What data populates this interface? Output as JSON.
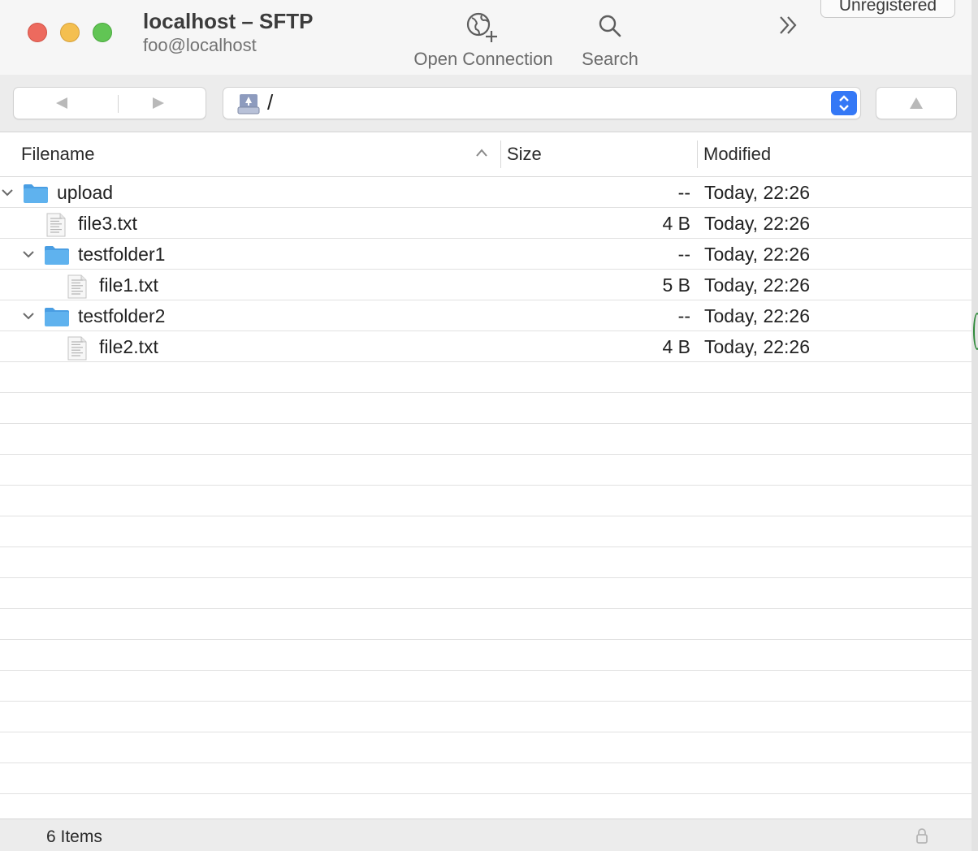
{
  "window": {
    "title": "localhost – SFTP",
    "subtitle": "foo@localhost"
  },
  "toolbar": {
    "open_connection_label": "Open Connection",
    "search_label": "Search",
    "unregistered_label": "Unregistered",
    "icons": {
      "open_connection": "globe-plus-icon",
      "search": "magnifier-icon",
      "more": "chevron-double-right-icon"
    }
  },
  "navigation": {
    "path": "/",
    "back_icon": "triangle-left-icon",
    "forward_icon": "triangle-right-icon",
    "up_icon": "triangle-up-icon"
  },
  "table": {
    "columns": {
      "filename": "Filename",
      "size": "Size",
      "modified": "Modified"
    },
    "sort": {
      "column": "Filename",
      "direction": "ascending"
    },
    "rows": [
      {
        "name": "upload",
        "type": "folder",
        "expanded": true,
        "depth": 0,
        "size": "--",
        "modified": "Today, 22:26"
      },
      {
        "name": "file3.txt",
        "type": "file",
        "depth": 1,
        "size": "4 B",
        "modified": "Today, 22:26"
      },
      {
        "name": "testfolder1",
        "type": "folder",
        "expanded": true,
        "depth": 1,
        "size": "--",
        "modified": "Today, 22:26"
      },
      {
        "name": "file1.txt",
        "type": "file",
        "depth": 2,
        "size": "5 B",
        "modified": "Today, 22:26"
      },
      {
        "name": "testfolder2",
        "type": "folder",
        "expanded": true,
        "depth": 1,
        "size": "--",
        "modified": "Today, 22:26"
      },
      {
        "name": "file2.txt",
        "type": "file",
        "depth": 2,
        "size": "4 B",
        "modified": "Today, 22:26"
      }
    ]
  },
  "status": {
    "item_count": "6 Items",
    "lock_icon": "padlock-icon"
  },
  "colors": {
    "accent": "#3478f6",
    "folder": "#5fb2ee",
    "close": "#ed6a5e",
    "minimize": "#f4bf4f",
    "zoom": "#61c554"
  }
}
